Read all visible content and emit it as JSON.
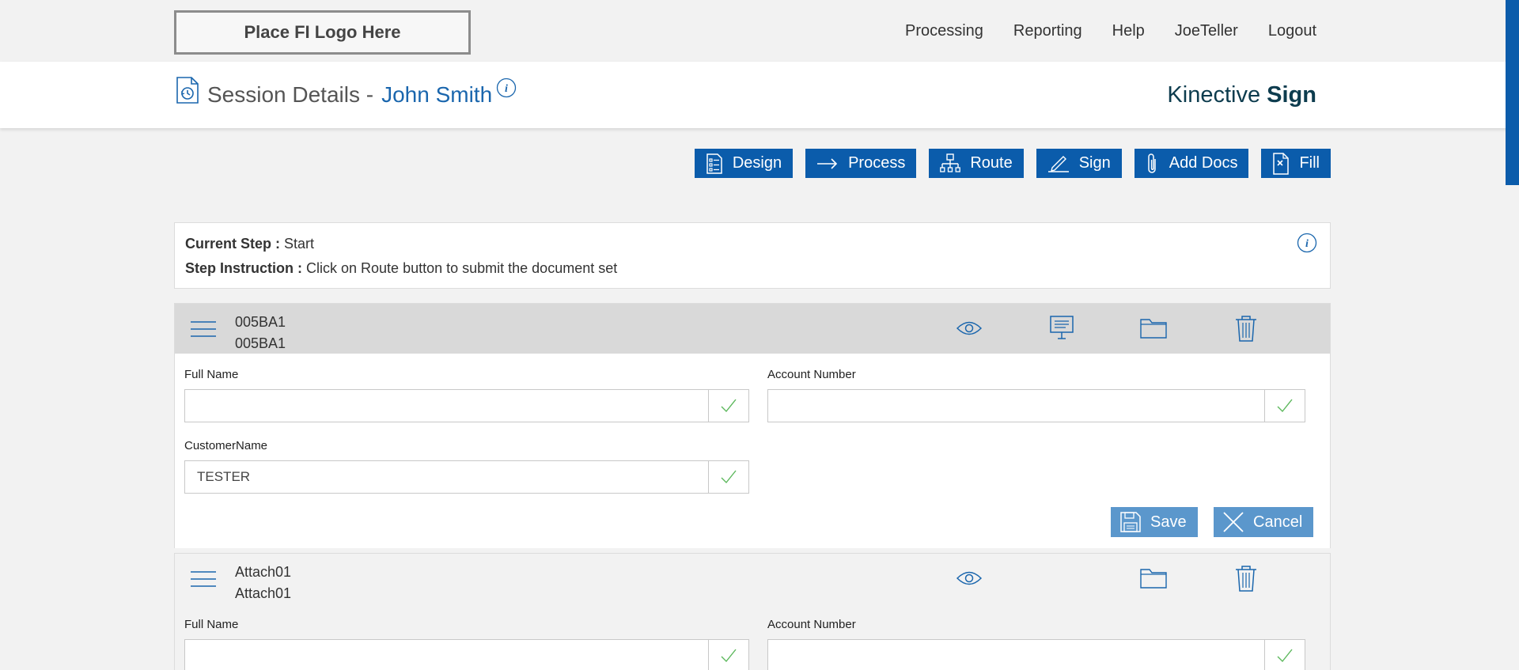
{
  "topbar": {
    "logo_text": "Place FI Logo Here",
    "nav": [
      "Processing",
      "Reporting",
      "Help",
      "JoeTeller",
      "Logout"
    ]
  },
  "header": {
    "title_prefix": "Session Details -",
    "customer_name": "John Smith",
    "brand_light": "Kinective",
    "brand_bold": "Sign"
  },
  "actions": {
    "design": "Design",
    "process": "Process",
    "route": "Route",
    "sign": "Sign",
    "add_docs": "Add Docs",
    "fill": "Fill"
  },
  "step": {
    "current_label": "Current Step :",
    "current_value": "Start",
    "instruction_label": "Step Instruction :",
    "instruction_value": "Click on Route button to submit the document set"
  },
  "documents": [
    {
      "title": "005BA1",
      "subtitle": "005BA1",
      "fields": {
        "full_name": {
          "label": "Full Name",
          "value": ""
        },
        "account_number": {
          "label": "Account Number",
          "value": ""
        },
        "customer_name": {
          "label": "CustomerName",
          "value": "TESTER"
        }
      },
      "save_label": "Save",
      "cancel_label": "Cancel"
    },
    {
      "title": "Attach01",
      "subtitle": "Attach01",
      "fields": {
        "full_name": {
          "label": "Full Name",
          "value": ""
        },
        "account_number": {
          "label": "Account Number",
          "value": ""
        }
      }
    }
  ],
  "colors": {
    "primary": "#0b5cab",
    "link": "#1a66ad",
    "secondary_button": "#5b97cc",
    "check": "#5cb85c",
    "doc_header": "#d9d9d9"
  }
}
